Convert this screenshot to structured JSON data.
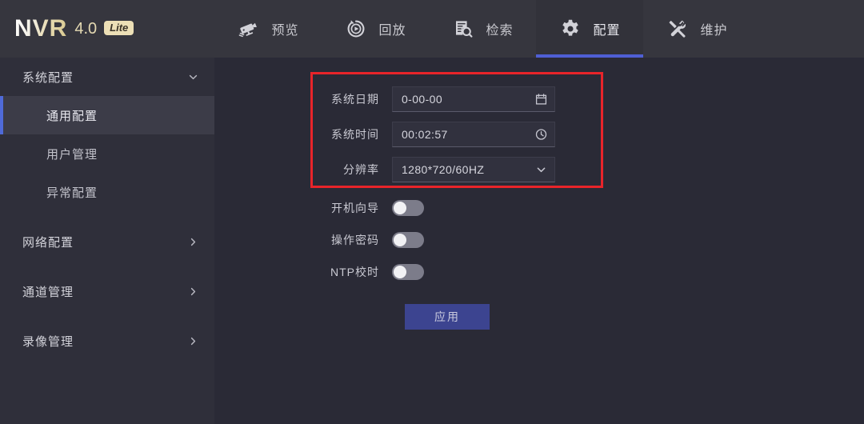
{
  "brand": {
    "name": "NVR",
    "version": "4.0",
    "edition": "Lite"
  },
  "nav": {
    "tabs": [
      {
        "label": "预览",
        "icon": "cctv-camera-icon",
        "active": false
      },
      {
        "label": "回放",
        "icon": "playback-replay-icon",
        "active": false
      },
      {
        "label": "检索",
        "icon": "document-search-icon",
        "active": false
      },
      {
        "label": "配置",
        "icon": "gear-icon",
        "active": true
      },
      {
        "label": "维护",
        "icon": "wrench-tools-icon",
        "active": false
      }
    ],
    "active_underline_color": "#4f5fd4"
  },
  "sidebar": {
    "items": [
      {
        "label": "系统配置",
        "type": "group",
        "expanded": true,
        "icon": "chevron-down-icon"
      },
      {
        "label": "通用配置",
        "type": "sub",
        "active": true
      },
      {
        "label": "用户管理",
        "type": "sub",
        "active": false
      },
      {
        "label": "异常配置",
        "type": "sub",
        "active": false
      },
      {
        "label": "网络配置",
        "type": "group",
        "expanded": false,
        "icon": "chevron-right-icon"
      },
      {
        "label": "通道管理",
        "type": "group",
        "expanded": false,
        "icon": "chevron-right-icon"
      },
      {
        "label": "录像管理",
        "type": "group",
        "expanded": false,
        "icon": "chevron-right-icon"
      }
    ],
    "active_accent_color": "#4f6ad8"
  },
  "form": {
    "fields": [
      {
        "label": "系统日期",
        "value": "0-00-00",
        "icon": "calendar-icon",
        "kind": "date"
      },
      {
        "label": "系统时间",
        "value": "00:02:57",
        "icon": "clock-icon",
        "kind": "time"
      },
      {
        "label": "分辨率",
        "value": "1280*720/60HZ",
        "icon": "chevron-down-icon",
        "kind": "select"
      }
    ],
    "toggles": [
      {
        "label": "开机向导",
        "on": false
      },
      {
        "label": "操作密码",
        "on": false
      },
      {
        "label": "NTP校时",
        "on": false
      }
    ],
    "apply_label": "应用"
  },
  "annotation": {
    "highlight_color": "#e8242a",
    "shape": "rectangle"
  }
}
